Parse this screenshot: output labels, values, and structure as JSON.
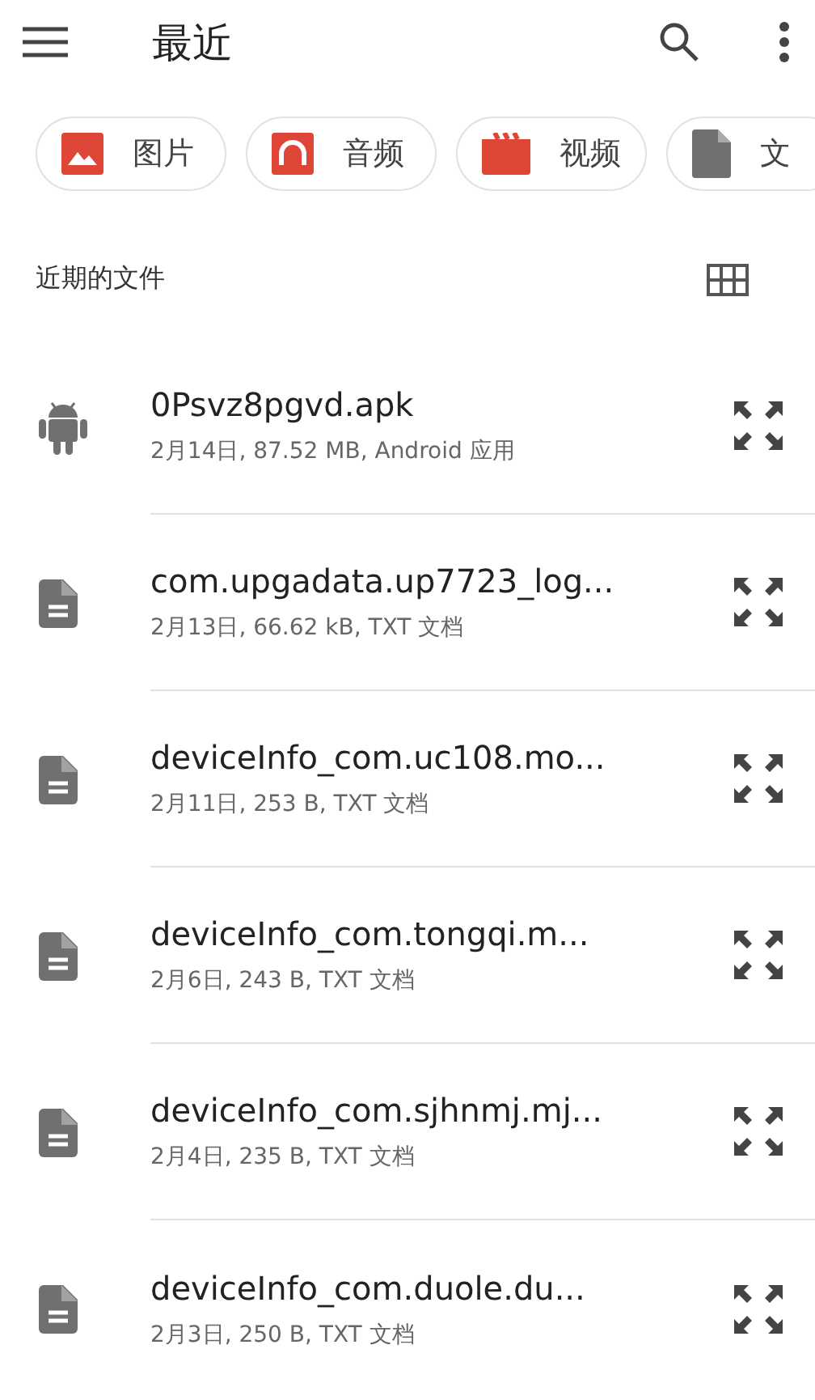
{
  "app_bar": {
    "title": "最近"
  },
  "chips": [
    {
      "label": "图片",
      "kind": "image"
    },
    {
      "label": "音频",
      "kind": "audio"
    },
    {
      "label": "视频",
      "kind": "video"
    },
    {
      "label": "文",
      "kind": "document"
    }
  ],
  "section": {
    "title": "近期的文件"
  },
  "files": [
    {
      "name": "0Psvz8pgvd.apk",
      "details": "2月14日, 87.52 MB, Android 应用",
      "kind": "android"
    },
    {
      "name": "com.upgadata.up7723_log...",
      "details": "2月13日, 66.62 kB, TXT 文档",
      "kind": "text"
    },
    {
      "name": "deviceInfo_com.uc108.mo...",
      "details": "2月11日, 253 B, TXT 文档",
      "kind": "text"
    },
    {
      "name": "deviceInfo_com.tongqi.m...",
      "details": "2月6日, 243 B, TXT 文档",
      "kind": "text"
    },
    {
      "name": "deviceInfo_com.sjhnmj.mj...",
      "details": "2月4日, 235 B, TXT 文档",
      "kind": "text"
    },
    {
      "name": "deviceInfo_com.duole.du...",
      "details": "2月3日, 250 B, TXT 文档",
      "kind": "text"
    }
  ]
}
